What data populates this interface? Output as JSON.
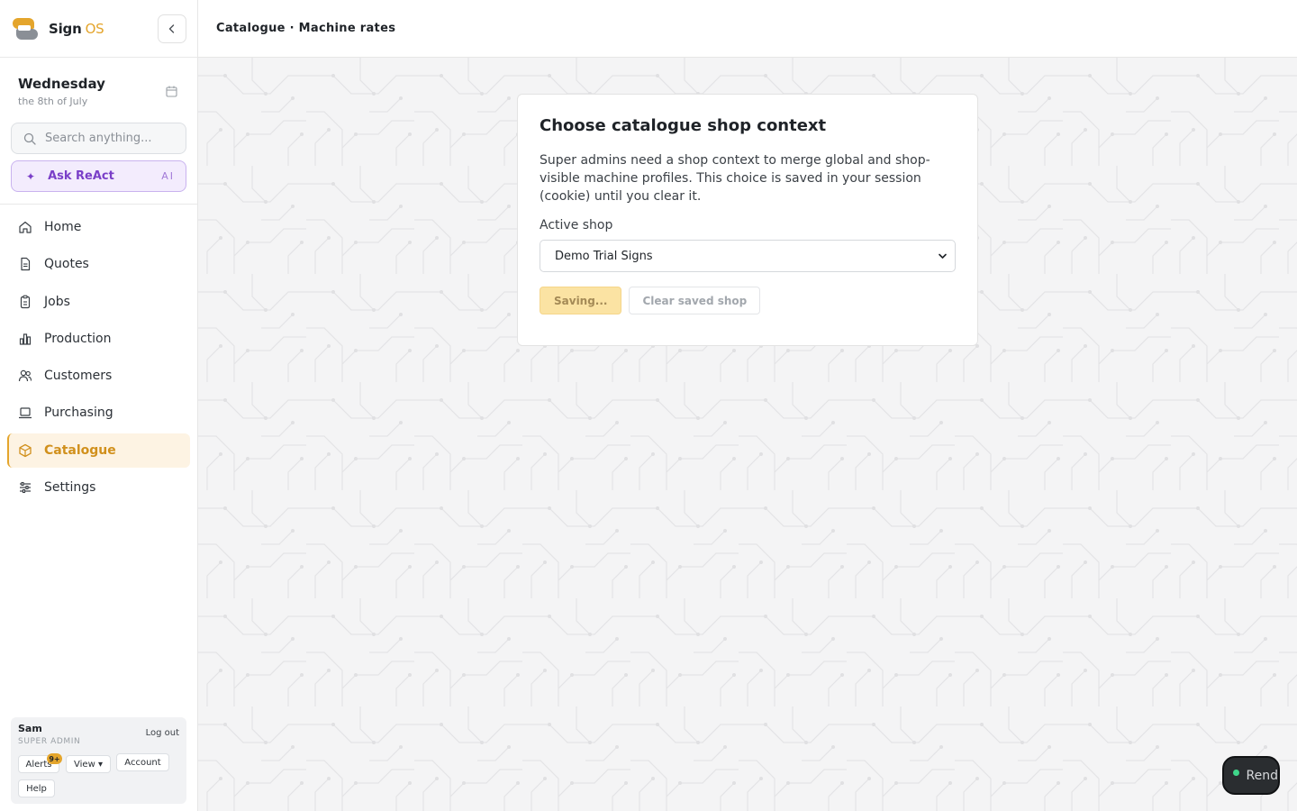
{
  "brand": {
    "name": "Sign",
    "suffix": "OS",
    "accent": "#e4a52c"
  },
  "sidebar": {
    "date_day": "Wednesday",
    "date_sub": "the 8th of July",
    "search_placeholder": "Search anything...",
    "ask_label": "Ask ReAct",
    "ask_tag": "AI",
    "nav": [
      {
        "label": "Home",
        "icon": "home-icon"
      },
      {
        "label": "Quotes",
        "icon": "document-icon"
      },
      {
        "label": "Jobs",
        "icon": "clipboard-icon"
      },
      {
        "label": "Production",
        "icon": "bar-chart-icon"
      },
      {
        "label": "Customers",
        "icon": "users-icon"
      },
      {
        "label": "Purchasing",
        "icon": "laptop-icon"
      },
      {
        "label": "Catalogue",
        "icon": "box-icon",
        "active": true
      },
      {
        "label": "Settings",
        "icon": "sliders-icon"
      }
    ],
    "user": {
      "name": "Sam",
      "role": "SUPER ADMIN",
      "logout": "Log out",
      "alerts": "Alerts",
      "alerts_badge": "9+",
      "view": "View ▾",
      "account": "Account",
      "help": "Help"
    }
  },
  "topbar": {
    "title": "Catalogue · Machine rates"
  },
  "modal": {
    "title": "Choose catalogue shop context",
    "description": "Super admins need a shop context to merge global and shop-visible machine profiles. This choice is saved in your session (cookie) until you clear it.",
    "field_label": "Active shop",
    "selected_shop": "Demo Trial Signs",
    "saving_label": "Saving...",
    "clear_label": "Clear saved shop"
  },
  "render_pill": {
    "label": "Rend"
  }
}
